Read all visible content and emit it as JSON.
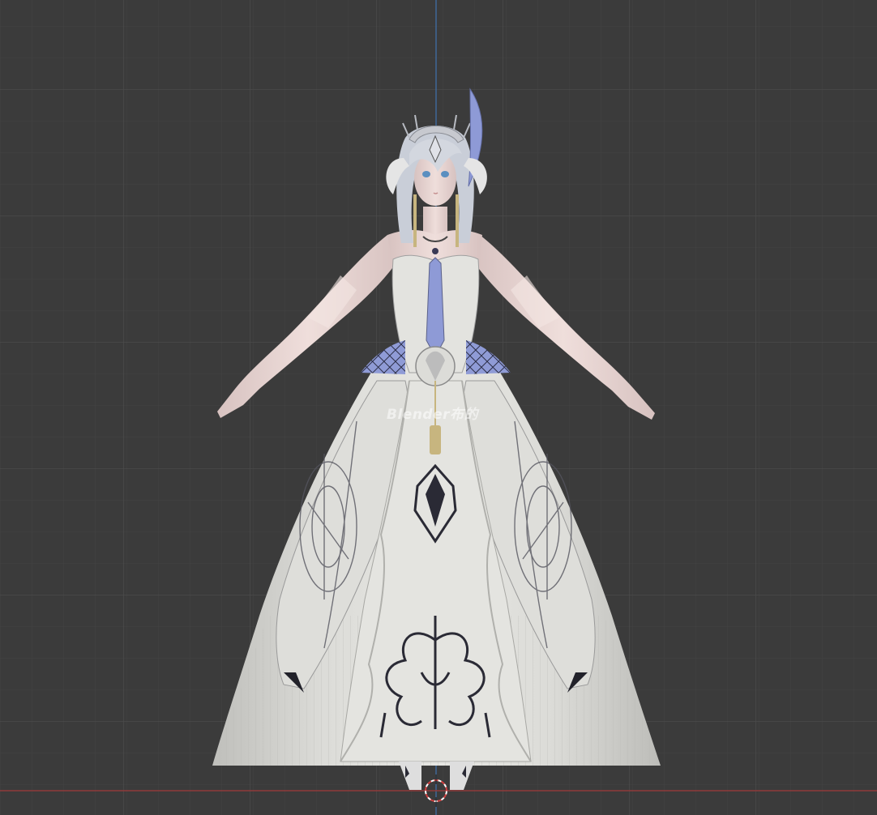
{
  "viewport": {
    "background": "#3c3c3c",
    "grid_minor_color": "#444444",
    "grid_major_color": "#4e4e4e",
    "axis_x_color": "#9a3a3a",
    "axis_z_color": "#3d6fa8",
    "cursor_icon": "3d-cursor-icon"
  },
  "model": {
    "skin_color": "#e9d6d4",
    "dress_color": "#d7d7d3",
    "dress_shadow": "#b9b9b6",
    "accent_color": "#8e9ad6",
    "ornament_color": "#2a2a35",
    "hair_color": "#c9ced8",
    "gold_color": "#c7b57f"
  },
  "watermark": {
    "text": "Blender布的"
  }
}
